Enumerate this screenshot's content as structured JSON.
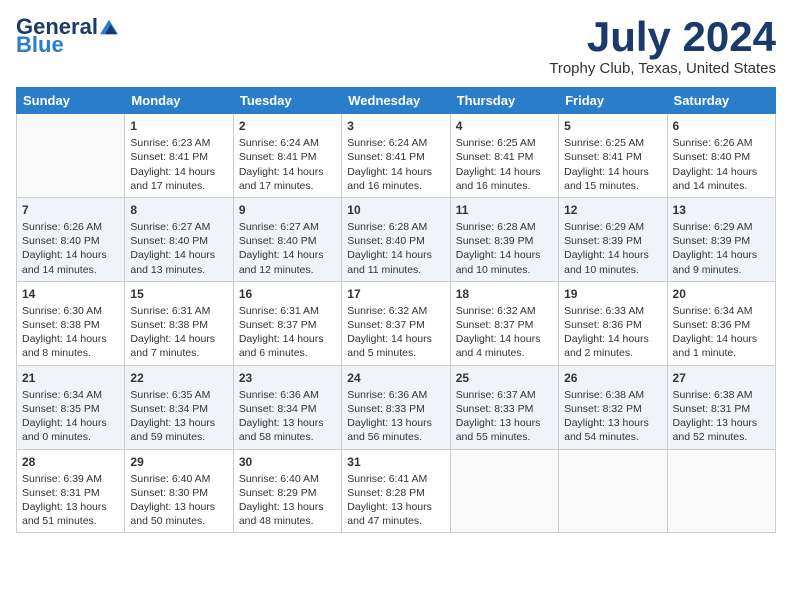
{
  "header": {
    "logo_general": "General",
    "logo_blue": "Blue",
    "month": "July 2024",
    "location": "Trophy Club, Texas, United States"
  },
  "columns": [
    "Sunday",
    "Monday",
    "Tuesday",
    "Wednesday",
    "Thursday",
    "Friday",
    "Saturday"
  ],
  "weeks": [
    [
      {
        "day": "",
        "content": ""
      },
      {
        "day": "1",
        "content": "Sunrise: 6:23 AM\nSunset: 8:41 PM\nDaylight: 14 hours\nand 17 minutes."
      },
      {
        "day": "2",
        "content": "Sunrise: 6:24 AM\nSunset: 8:41 PM\nDaylight: 14 hours\nand 17 minutes."
      },
      {
        "day": "3",
        "content": "Sunrise: 6:24 AM\nSunset: 8:41 PM\nDaylight: 14 hours\nand 16 minutes."
      },
      {
        "day": "4",
        "content": "Sunrise: 6:25 AM\nSunset: 8:41 PM\nDaylight: 14 hours\nand 16 minutes."
      },
      {
        "day": "5",
        "content": "Sunrise: 6:25 AM\nSunset: 8:41 PM\nDaylight: 14 hours\nand 15 minutes."
      },
      {
        "day": "6",
        "content": "Sunrise: 6:26 AM\nSunset: 8:40 PM\nDaylight: 14 hours\nand 14 minutes."
      }
    ],
    [
      {
        "day": "7",
        "content": "Sunrise: 6:26 AM\nSunset: 8:40 PM\nDaylight: 14 hours\nand 14 minutes."
      },
      {
        "day": "8",
        "content": "Sunrise: 6:27 AM\nSunset: 8:40 PM\nDaylight: 14 hours\nand 13 minutes."
      },
      {
        "day": "9",
        "content": "Sunrise: 6:27 AM\nSunset: 8:40 PM\nDaylight: 14 hours\nand 12 minutes."
      },
      {
        "day": "10",
        "content": "Sunrise: 6:28 AM\nSunset: 8:40 PM\nDaylight: 14 hours\nand 11 minutes."
      },
      {
        "day": "11",
        "content": "Sunrise: 6:28 AM\nSunset: 8:39 PM\nDaylight: 14 hours\nand 10 minutes."
      },
      {
        "day": "12",
        "content": "Sunrise: 6:29 AM\nSunset: 8:39 PM\nDaylight: 14 hours\nand 10 minutes."
      },
      {
        "day": "13",
        "content": "Sunrise: 6:29 AM\nSunset: 8:39 PM\nDaylight: 14 hours\nand 9 minutes."
      }
    ],
    [
      {
        "day": "14",
        "content": "Sunrise: 6:30 AM\nSunset: 8:38 PM\nDaylight: 14 hours\nand 8 minutes."
      },
      {
        "day": "15",
        "content": "Sunrise: 6:31 AM\nSunset: 8:38 PM\nDaylight: 14 hours\nand 7 minutes."
      },
      {
        "day": "16",
        "content": "Sunrise: 6:31 AM\nSunset: 8:37 PM\nDaylight: 14 hours\nand 6 minutes."
      },
      {
        "day": "17",
        "content": "Sunrise: 6:32 AM\nSunset: 8:37 PM\nDaylight: 14 hours\nand 5 minutes."
      },
      {
        "day": "18",
        "content": "Sunrise: 6:32 AM\nSunset: 8:37 PM\nDaylight: 14 hours\nand 4 minutes."
      },
      {
        "day": "19",
        "content": "Sunrise: 6:33 AM\nSunset: 8:36 PM\nDaylight: 14 hours\nand 2 minutes."
      },
      {
        "day": "20",
        "content": "Sunrise: 6:34 AM\nSunset: 8:36 PM\nDaylight: 14 hours\nand 1 minute."
      }
    ],
    [
      {
        "day": "21",
        "content": "Sunrise: 6:34 AM\nSunset: 8:35 PM\nDaylight: 14 hours\nand 0 minutes."
      },
      {
        "day": "22",
        "content": "Sunrise: 6:35 AM\nSunset: 8:34 PM\nDaylight: 13 hours\nand 59 minutes."
      },
      {
        "day": "23",
        "content": "Sunrise: 6:36 AM\nSunset: 8:34 PM\nDaylight: 13 hours\nand 58 minutes."
      },
      {
        "day": "24",
        "content": "Sunrise: 6:36 AM\nSunset: 8:33 PM\nDaylight: 13 hours\nand 56 minutes."
      },
      {
        "day": "25",
        "content": "Sunrise: 6:37 AM\nSunset: 8:33 PM\nDaylight: 13 hours\nand 55 minutes."
      },
      {
        "day": "26",
        "content": "Sunrise: 6:38 AM\nSunset: 8:32 PM\nDaylight: 13 hours\nand 54 minutes."
      },
      {
        "day": "27",
        "content": "Sunrise: 6:38 AM\nSunset: 8:31 PM\nDaylight: 13 hours\nand 52 minutes."
      }
    ],
    [
      {
        "day": "28",
        "content": "Sunrise: 6:39 AM\nSunset: 8:31 PM\nDaylight: 13 hours\nand 51 minutes."
      },
      {
        "day": "29",
        "content": "Sunrise: 6:40 AM\nSunset: 8:30 PM\nDaylight: 13 hours\nand 50 minutes."
      },
      {
        "day": "30",
        "content": "Sunrise: 6:40 AM\nSunset: 8:29 PM\nDaylight: 13 hours\nand 48 minutes."
      },
      {
        "day": "31",
        "content": "Sunrise: 6:41 AM\nSunset: 8:28 PM\nDaylight: 13 hours\nand 47 minutes."
      },
      {
        "day": "",
        "content": ""
      },
      {
        "day": "",
        "content": ""
      },
      {
        "day": "",
        "content": ""
      }
    ]
  ]
}
